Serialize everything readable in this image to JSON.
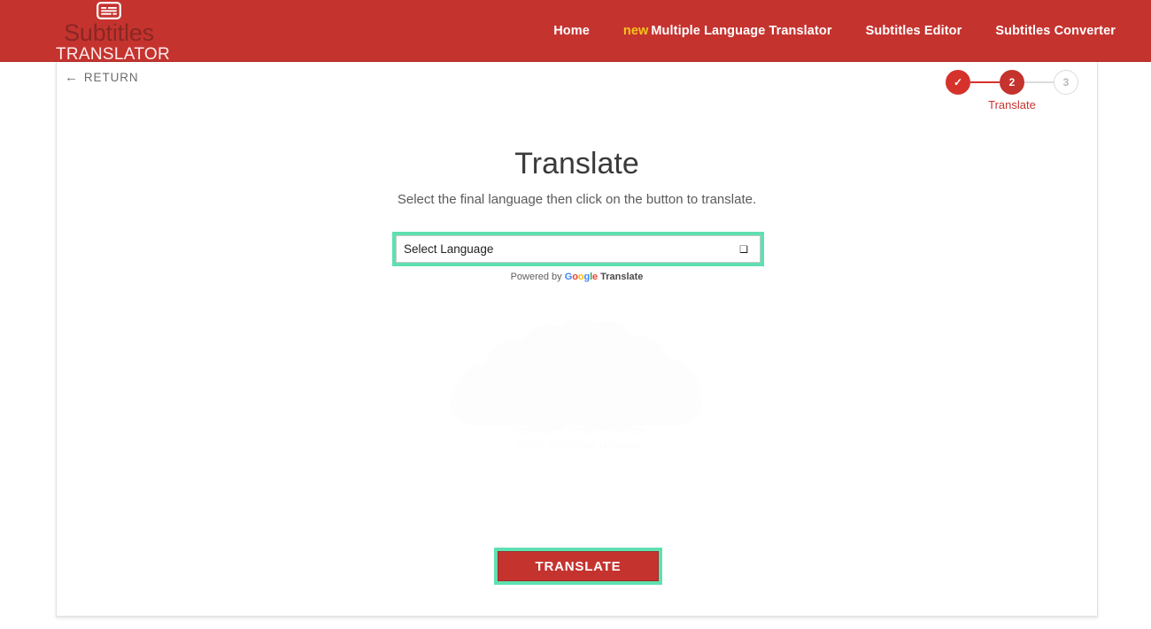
{
  "site": {
    "logo_icon": "subtitles-icon",
    "logo_top": "Subtitles",
    "logo_bottom": "TRANSLATOR",
    "header_color": "#c5332f"
  },
  "nav": {
    "items": [
      {
        "label": "Home",
        "badge": ""
      },
      {
        "label": "Multiple Language Translator",
        "badge": "new"
      },
      {
        "label": "Subtitles Editor",
        "badge": ""
      },
      {
        "label": "Subtitles Converter",
        "badge": ""
      }
    ]
  },
  "card": {
    "return": {
      "arrow": "←",
      "label": "RETURN"
    },
    "stepper": {
      "steps": [
        {
          "value": "✓",
          "state": "done"
        },
        {
          "value": "2",
          "state": "active"
        },
        {
          "value": "3",
          "state": "todo"
        }
      ],
      "active_label": "Translate"
    },
    "title": "Translate",
    "subtitle": "Select the final language then click on the button to translate.",
    "language_select": {
      "value": "Select Language",
      "options": [
        "Select Language"
      ],
      "chevron": "✔",
      "highlight_color": "#5fe0b0"
    },
    "powered_by": {
      "prefix": "Powered by",
      "google": [
        "G",
        "o",
        "o",
        "g",
        "l",
        "e"
      ],
      "suffix": "Translate"
    },
    "watermark_caption_line1": "Powered by Google Translate",
    "watermark_caption_line2": "Select your target language",
    "translate_button": {
      "label": "TRANSLATE",
      "color": "#c5332f",
      "highlight_color": "#5fe0b0"
    }
  }
}
